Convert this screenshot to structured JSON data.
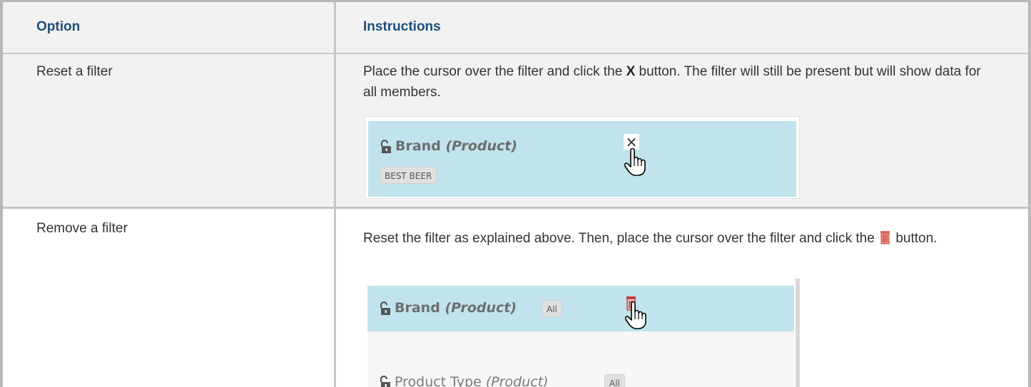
{
  "table": {
    "headers": {
      "option": "Option",
      "instructions": "Instructions"
    },
    "rows": [
      {
        "option": "Reset a filter",
        "instructions": {
          "part1": "Place the cursor over the filter and click the ",
          "bold": "X",
          "part2": " button. The filter will still be present but will show data for all members."
        },
        "screenshot": {
          "filter_name": "Brand",
          "filter_dimension": "(Product)",
          "member_tag": "BEST BEER",
          "close_glyph": "×"
        }
      },
      {
        "option": "Remove a filter",
        "instructions": {
          "part1": "Reset the filter as explained above. Then, place the cursor over the filter and click the ",
          "part2": " button."
        },
        "screenshot": {
          "filter1_name": "Brand",
          "filter1_dimension": "(Product)",
          "filter1_tag": "All",
          "filter2_name": "Product Type",
          "filter2_dimension": "(Product)",
          "filter2_tag": "All"
        }
      }
    ]
  },
  "icons": {
    "lock": "lock-icon",
    "close": "close-icon",
    "trash": "trash-icon",
    "cursor": "hand-cursor-icon"
  },
  "colors": {
    "header_text": "#1f4e79",
    "filter_bg": "#c0e3ec",
    "trash_red": "#c0392b"
  }
}
